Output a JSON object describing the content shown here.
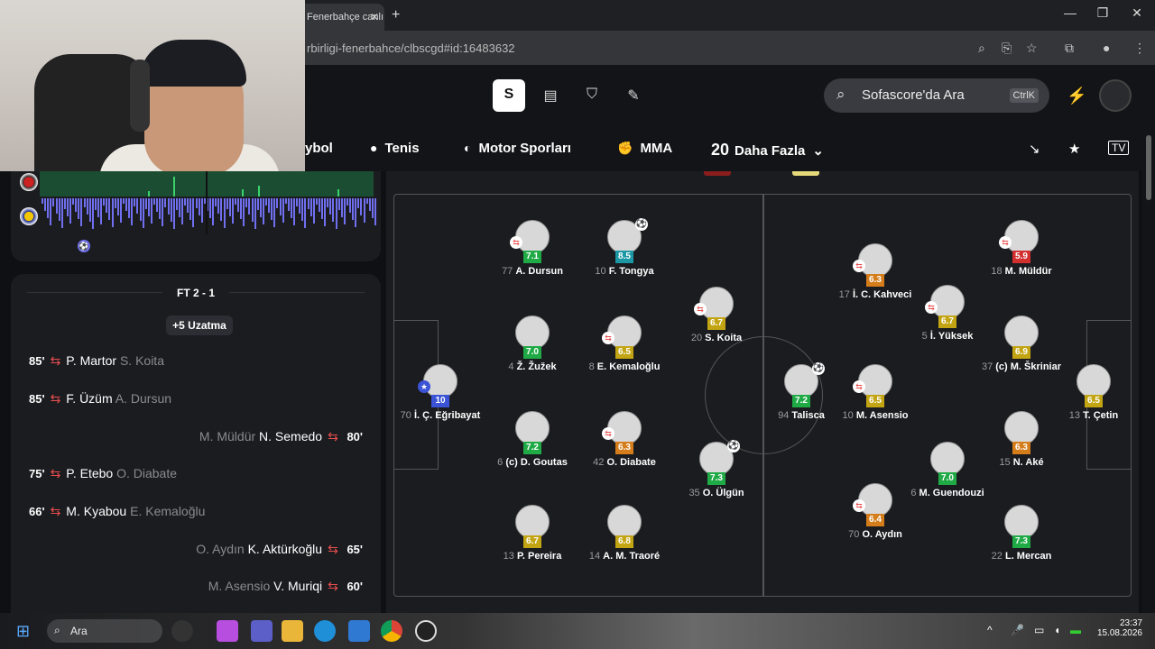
{
  "browser": {
    "tab_title": "Fenerbahçe canlı",
    "url": "rbirligi-fenerbahce/clbscgd#id:16483632",
    "new_tab": "+"
  },
  "header": {
    "search_placeholder": "Sofascore'da Ara",
    "search_shortcut": "CtrlK",
    "sports": [
      {
        "label": "ybol"
      },
      {
        "label": "Tenis"
      },
      {
        "label": "Motor Sporları"
      },
      {
        "label": "MMA"
      },
      {
        "label": "Daha Fazla",
        "count": "20"
      }
    ]
  },
  "momentum": {
    "goal_icon": "soccer-ball-icon"
  },
  "ft": {
    "score": "FT 2 - 1",
    "extra_time": "+5 Uzatma",
    "subs": [
      {
        "minute": "85'",
        "in": "P. Martor",
        "out": "S. Koita",
        "side": "home"
      },
      {
        "minute": "85'",
        "in": "F. Üzüm",
        "out": "A. Dursun",
        "side": "home"
      },
      {
        "minute": "80'",
        "in": "N. Semedo",
        "out": "M. Müldür",
        "side": "away"
      },
      {
        "minute": "75'",
        "in": "P. Etebo",
        "out": "O. Diabate",
        "side": "home"
      },
      {
        "minute": "66'",
        "in": "M. Kyabou",
        "out": "E. Kemaloğlu",
        "side": "home"
      },
      {
        "minute": "65'",
        "in": "K. Aktürkoğlu",
        "out": "O. Aydın",
        "side": "away"
      },
      {
        "minute": "60'",
        "in": "V. Muriqi",
        "out": "M. Asensio",
        "side": "away"
      }
    ]
  },
  "pitch": {
    "home": [
      {
        "num": "70",
        "name": "İ. Ç. Eğribayat",
        "rating": "10",
        "color": "blue"
      },
      {
        "num": "77",
        "name": "A. Dursun",
        "rating": "7.1",
        "color": "green"
      },
      {
        "num": "10",
        "name": "F. Tongya",
        "rating": "8.5",
        "color": "teal"
      },
      {
        "num": "20",
        "name": "S. Koita",
        "rating": "6.7",
        "color": "yellow"
      },
      {
        "num": "4",
        "name": "Ž. Žužek",
        "rating": "7.0",
        "color": "green"
      },
      {
        "num": "8",
        "name": "E. Kemaloğlu",
        "rating": "6.5",
        "color": "yellow"
      },
      {
        "num": "6",
        "name": "(c) D. Goutas",
        "rating": "7.2",
        "color": "green"
      },
      {
        "num": "42",
        "name": "O. Diabate",
        "rating": "6.3",
        "color": "orange"
      },
      {
        "num": "35",
        "name": "O. Ülgün",
        "rating": "7.3",
        "color": "green"
      },
      {
        "num": "13",
        "name": "P. Pereira",
        "rating": "6.7",
        "color": "yellow"
      },
      {
        "num": "14",
        "name": "A. M. Traoré",
        "rating": "6.8",
        "color": "yellow"
      }
    ],
    "away": [
      {
        "num": "18",
        "name": "M. Müldür",
        "rating": "5.9",
        "color": "red"
      },
      {
        "num": "17",
        "name": "İ. C. Kahveci",
        "rating": "6.3",
        "color": "orange"
      },
      {
        "num": "5",
        "name": "İ. Yüksek",
        "rating": "6.7",
        "color": "yellow"
      },
      {
        "num": "37",
        "name": "(c) M. Škriniar",
        "rating": "6.9",
        "color": "yellow"
      },
      {
        "num": "94",
        "name": "Talisca",
        "rating": "7.2",
        "color": "green"
      },
      {
        "num": "10",
        "name": "M. Asensio",
        "rating": "6.5",
        "color": "yellow"
      },
      {
        "num": "13",
        "name": "T. Çetin",
        "rating": "6.5",
        "color": "yellow"
      },
      {
        "num": "15",
        "name": "N. Aké",
        "rating": "6.3",
        "color": "orange"
      },
      {
        "num": "6",
        "name": "M. Guendouzi",
        "rating": "7.0",
        "color": "green"
      },
      {
        "num": "70",
        "name": "O. Aydın",
        "rating": "6.4",
        "color": "orange"
      },
      {
        "num": "22",
        "name": "L. Mercan",
        "rating": "7.3",
        "color": "green"
      }
    ]
  },
  "taskbar": {
    "search": "Ara",
    "time": "23:37",
    "date": "15.08.2026"
  }
}
